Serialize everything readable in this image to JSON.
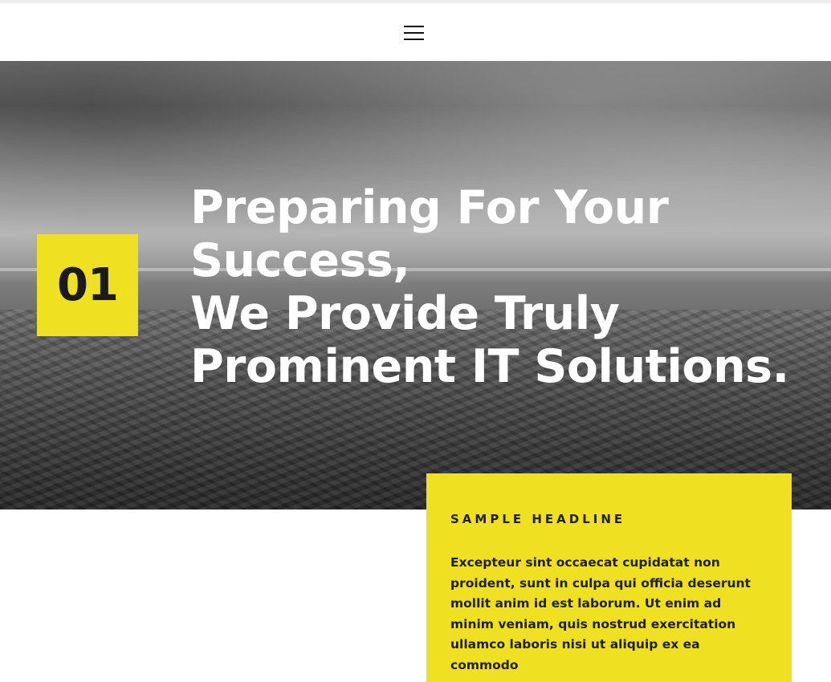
{
  "header": {
    "menu_icon": "hamburger-menu-icon"
  },
  "hero": {
    "badge_number": "01",
    "title_lines": [
      "Preparing For Your",
      "Success,",
      "We Provide Truly",
      "Prominent IT Solutions."
    ]
  },
  "card": {
    "eyebrow": "SAMPLE HEADLINE",
    "body": "Excepteur sint occaecat cupidatat non proident, sunt in culpa qui officia deserunt mollit anim id est laborum. Ut enim ad minim veniam, quis nostrud exercitation ullamco laboris nisi ut aliquip ex ea commodo"
  },
  "colors": {
    "accent_yellow": "#efe021",
    "text_dark": "#1b1b1b",
    "white": "#ffffff"
  }
}
